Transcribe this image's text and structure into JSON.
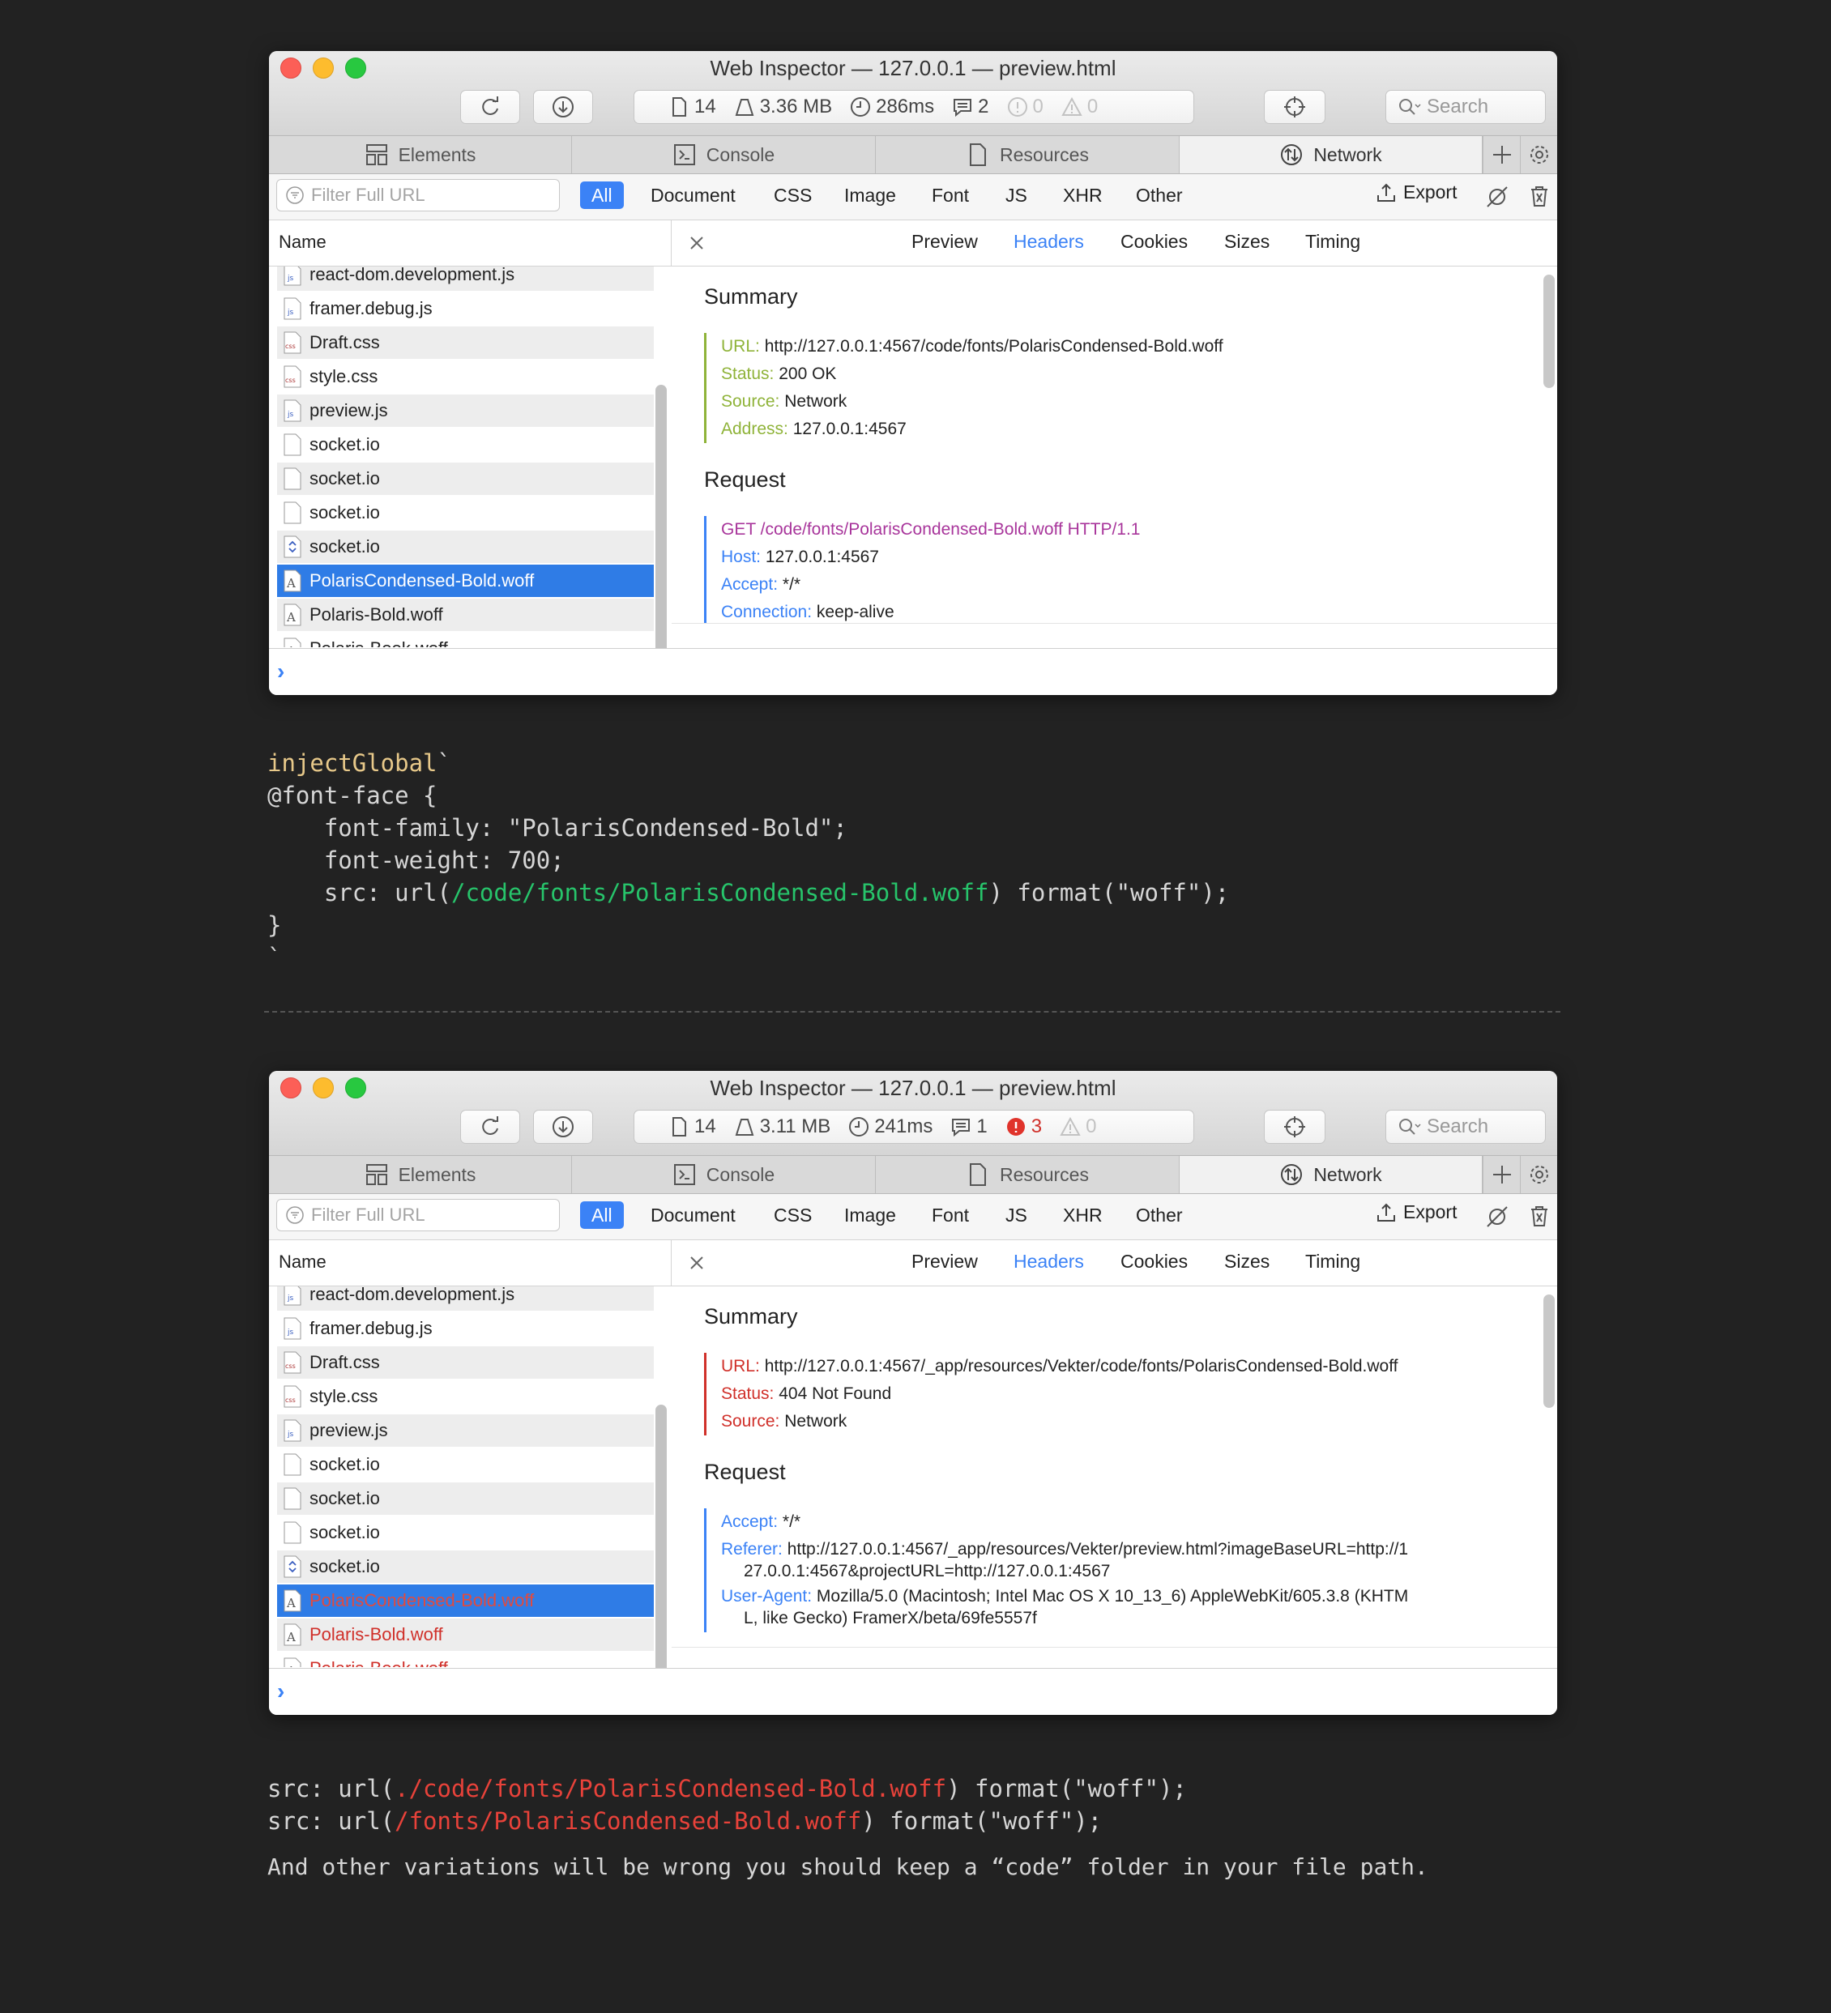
{
  "window1": {
    "title": "Web Inspector — 127.0.0.1 — preview.html",
    "stats": {
      "resources": "14",
      "size": "3.36 MB",
      "time": "286ms",
      "logs": "2",
      "errors": "0",
      "warnings": "0"
    },
    "search_placeholder": "Search",
    "summary": {
      "url_label": "URL:",
      "url": "http://127.0.0.1:4567/code/fonts/PolarisCondensed-Bold.woff",
      "status_label": "Status:",
      "status": "200 OK",
      "source_label": "Source:",
      "source": "Network",
      "address_label": "Address:",
      "address": "127.0.0.1:4567"
    },
    "request": {
      "line": "GET /code/fonts/PolarisCondensed-Bold.woff HTTP/1.1",
      "host_label": "Host:",
      "host": "127.0.0.1:4567",
      "accept_label": "Accept:",
      "accept": "*/*",
      "connection_label": "Connection:",
      "connection": "keep-alive"
    }
  },
  "window2": {
    "title": "Web Inspector — 127.0.0.1 — preview.html",
    "stats": {
      "resources": "14",
      "size": "3.11 MB",
      "time": "241ms",
      "logs": "1",
      "errors": "3",
      "warnings": "0"
    },
    "search_placeholder": "Search",
    "summary": {
      "url_label": "URL:",
      "url": "http://127.0.0.1:4567/_app/resources/Vekter/code/fonts/PolarisCondensed-Bold.woff",
      "status_label": "Status:",
      "status": "404 Not Found",
      "source_label": "Source:",
      "source": "Network"
    },
    "request": {
      "accept_label": "Accept:",
      "accept": "*/*",
      "referer_label": "Referer:",
      "referer_1": "http://127.0.0.1:4567/_app/resources/Vekter/preview.html?imageBaseURL=http://1",
      "referer_2": "27.0.0.1:4567&projectURL=http://127.0.0.1:4567",
      "ua_label": "User-Agent:",
      "ua_1": "Mozilla/5.0 (Macintosh; Intel Mac OS X 10_13_6) AppleWebKit/605.3.8 (KHTM",
      "ua_2": "L, like Gecko) FramerX/beta/69fe5557f"
    }
  },
  "tabs": {
    "elements": "Elements",
    "console": "Console",
    "resources": "Resources",
    "network": "Network"
  },
  "filter": {
    "placeholder": "Filter Full URL",
    "types": [
      "All",
      "Document",
      "CSS",
      "Image",
      "Font",
      "JS",
      "XHR",
      "Other"
    ],
    "export": "Export"
  },
  "list_header": "Name",
  "detail_tabs": [
    "Preview",
    "Headers",
    "Cookies",
    "Sizes",
    "Timing"
  ],
  "sections": {
    "summary": "Summary",
    "request": "Request"
  },
  "files": [
    {
      "name": "react-dom.development.js",
      "icon": "js-file-icon"
    },
    {
      "name": "framer.debug.js",
      "icon": "js-file-icon"
    },
    {
      "name": "Draft.css",
      "icon": "css-file-icon"
    },
    {
      "name": "style.css",
      "icon": "css-file-icon"
    },
    {
      "name": "preview.js",
      "icon": "js-file-icon"
    },
    {
      "name": "socket.io",
      "icon": "blank-file-icon"
    },
    {
      "name": "socket.io",
      "icon": "blank-file-icon"
    },
    {
      "name": "socket.io",
      "icon": "blank-file-icon"
    },
    {
      "name": "socket.io",
      "icon": "websocket-icon"
    },
    {
      "name": "PolarisCondensed-Bold.woff",
      "icon": "font-file-icon"
    },
    {
      "name": "Polaris-Bold.woff",
      "icon": "font-file-icon"
    },
    {
      "name": "Polaris-Book.woff",
      "icon": "font-file-icon"
    }
  ],
  "code1": {
    "l1_fn": "injectGlobal",
    "l1_tick": "`",
    "l2": "@font-face {",
    "l3": "    font-family: \"PolarisCondensed-Bold\";",
    "l4": "    font-weight: 700;",
    "l5_pre": "    src: url(",
    "l5_path": "/code/fonts/PolarisCondensed-Bold.woff",
    "l5_post": ") format(\"woff\");",
    "l6": "}",
    "l7": "`"
  },
  "code2": {
    "a_pre": "src: url(",
    "a_path": "./code/fonts/PolarisCondensed-Bold.woff",
    "a_post": ") format(\"woff\");",
    "b_pre": "src: url(",
    "b_path": "/fonts/PolarisCondensed-Bold.woff",
    "b_post": ") format(\"woff\");"
  },
  "note": "And other variations will be wrong you should keep a “code” folder in your file path.",
  "colors": {
    "accent": "#3b82f6",
    "selected": "#2f7ce6",
    "ok": "#8fb339",
    "error": "#d0302a",
    "code_path_ok": "#27c46b",
    "code_path_bad": "#e8423a"
  }
}
